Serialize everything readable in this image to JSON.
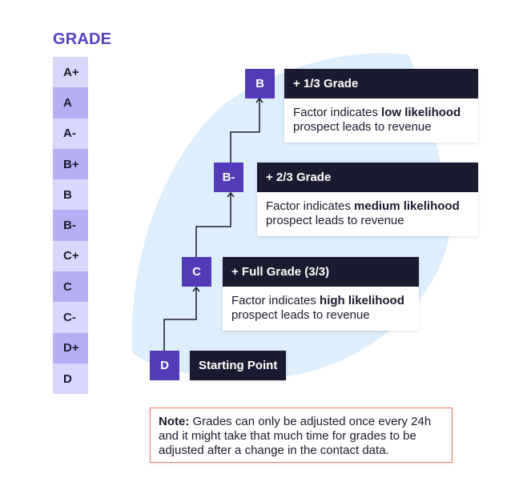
{
  "title": "GRADE",
  "grades": [
    "A+",
    "A",
    "A-",
    "B+",
    "B",
    "B-",
    "C+",
    "C",
    "C-",
    "D+",
    "D"
  ],
  "colors": {
    "accent": "#5a3fc4",
    "node": "#523ab8",
    "card_header": "#1a1a30",
    "grade_light": "#d9d7fb",
    "grade_dark": "#b5b0f6",
    "background_blob": "#ddeefc",
    "note_border": "#f07a62"
  },
  "steps": [
    {
      "grade": "D",
      "label": "Starting Point"
    },
    {
      "grade": "C",
      "header": "+ Full Grade (3/3)",
      "text_before": "Factor indicates ",
      "text_bold": "high likelihood",
      "text_after": " prospect leads to revenue"
    },
    {
      "grade": "B-",
      "header": "+ 2/3 Grade",
      "text_before": "Factor indicates ",
      "text_bold": "medium likelihood",
      "text_after": " prospect leads to revenue"
    },
    {
      "grade": "B",
      "header": "+ 1/3 Grade",
      "text_before": "Factor indicates ",
      "text_bold": "low likelihood",
      "text_after": " prospect leads to revenue"
    }
  ],
  "note": {
    "label": "Note:",
    "text": " Grades can only be adjusted once every 24h and it might take that much time for grades to be adjusted after a change in the contact data."
  }
}
